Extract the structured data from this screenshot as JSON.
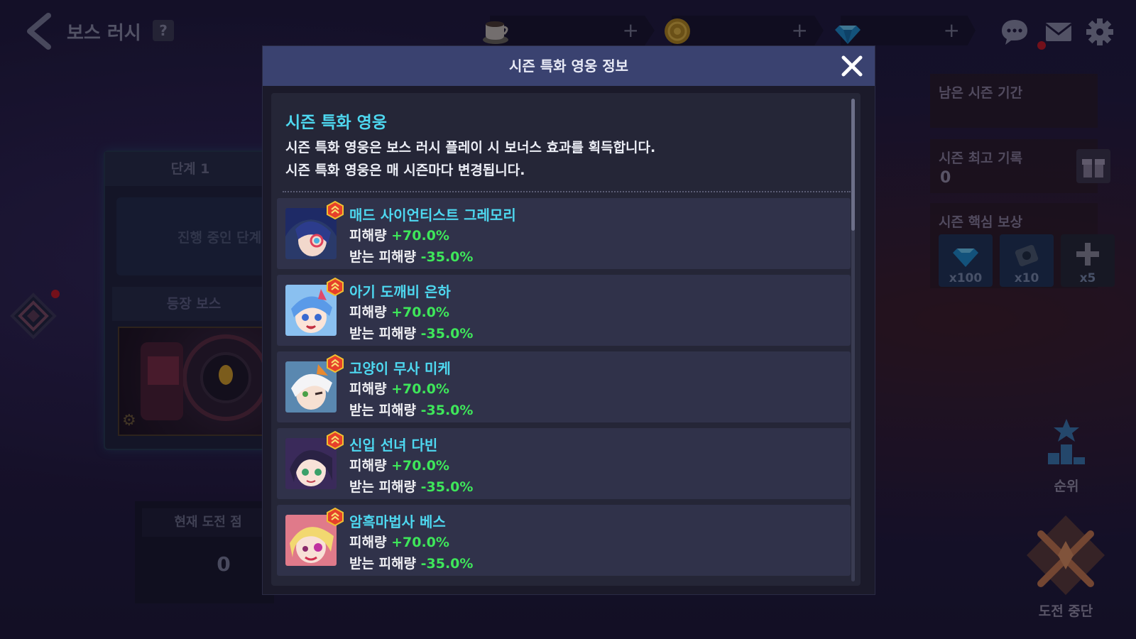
{
  "header": {
    "title": "보스 러시",
    "help_label": "?",
    "currencies": [
      {
        "icon": "coffee-cup-icon",
        "add_label": "+"
      },
      {
        "icon": "gold-coin-icon",
        "add_label": "+"
      },
      {
        "icon": "blue-gem-icon",
        "add_label": "+"
      }
    ]
  },
  "left": {
    "stage_label": "단계 1",
    "stage_status": "진행 중인 단계",
    "boss_label": "등장 보스",
    "score_label": "현재 도전 점",
    "score_value": "0"
  },
  "right": {
    "season_remaining_label": "남은 시즌 기간",
    "season_best_label": "시즌 최고 기록",
    "season_best_value": "0",
    "season_reward_label": "시즌 핵심 보상",
    "rewards": [
      {
        "icon": "blue-gem-icon",
        "count": "x100"
      },
      {
        "icon": "camera-ticket-icon",
        "count": "x10"
      },
      {
        "icon": "plus-icon",
        "count": "x5"
      }
    ],
    "ranking_label": "순위",
    "giveup_label": "도전 중단"
  },
  "modal": {
    "title": "시즌 특화 영웅 정보",
    "intro_title": "시즌 특화 영웅",
    "intro_line1": "시즌 특화 영웅은 보스 러시 플레이 시 보너스 효과를 획득합니다.",
    "intro_line2": "시즌 특화 영웅은 매 시즌마다 변경됩니다.",
    "damage_label": "피해량",
    "taken_label": "받는 피해량",
    "heroes": [
      {
        "name": "매드 사이언티스트 그레모리",
        "damage": "+70.0%",
        "taken": "-35.0%"
      },
      {
        "name": "아기 도깨비 은하",
        "damage": "+70.0%",
        "taken": "-35.0%"
      },
      {
        "name": "고양이 무사 미케",
        "damage": "+70.0%",
        "taken": "-35.0%"
      },
      {
        "name": "신입 선녀 다빈",
        "damage": "+70.0%",
        "taken": "-35.0%"
      },
      {
        "name": "암흑마법사 베스",
        "damage": "+70.0%",
        "taken": "-35.0%"
      }
    ]
  },
  "colors": {
    "accent_cyan": "#4ed8f0",
    "bonus_green": "#3ee65a",
    "modal_header": "#3a4270",
    "notification_red": "#c8161c"
  }
}
